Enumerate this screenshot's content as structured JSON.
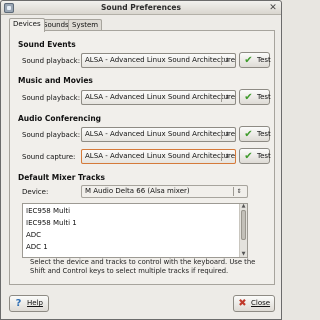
{
  "window": {
    "title": "Sound Preferences",
    "app_icon": "sound-preferences-icon",
    "close_glyph": "✕"
  },
  "tabs": [
    {
      "label": "Devices",
      "active": true
    },
    {
      "label": "Sounds",
      "active": false
    },
    {
      "label": "System Beep",
      "active": false
    }
  ],
  "sound_events": {
    "title": "Sound Events",
    "playback_label": "Sound playback:",
    "playback_value": "ALSA - Advanced Linux Sound Architecture",
    "test_label": "Test"
  },
  "music_movies": {
    "title": "Music and Movies",
    "playback_label": "Sound playback:",
    "playback_value": "ALSA - Advanced Linux Sound Architecture",
    "test_label": "Test"
  },
  "audio_conferencing": {
    "title": "Audio Conferencing",
    "playback_label": "Sound playback:",
    "playback_value": "ALSA - Advanced Linux Sound Architecture",
    "playback_test_label": "Test",
    "capture_label": "Sound capture:",
    "capture_value": "ALSA - Advanced Linux Sound Architecture",
    "capture_test_label": "Test"
  },
  "mixer": {
    "title": "Default Mixer Tracks",
    "device_label": "Device:",
    "device_value": "M Audio Delta 66 (Alsa mixer)",
    "tracks": [
      "IEC958 Multi",
      "IEC958 Multi 1",
      "ADC",
      "ADC 1"
    ],
    "help_text": "Select the device and tracks to control with the keyboard. Use the Shift and Control keys to select multiple tracks if required."
  },
  "footer": {
    "help_label": "Help",
    "close_label": "Close"
  },
  "colors": {
    "accent_focus": "#d57a3a",
    "check_green": "#3f9b2c",
    "close_red": "#c0392b"
  }
}
